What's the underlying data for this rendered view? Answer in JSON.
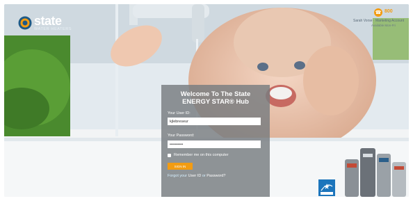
{
  "brand": {
    "logo_text": "state",
    "logo_subtext": "WATER HEATERS"
  },
  "contact": {
    "phone": "800",
    "name": "Sarah Vorse · Marketing Account",
    "hours": "Available Mon-Fri"
  },
  "login": {
    "title": "Welcome To The State ENERGY STAR® Hub",
    "user_id_label": "Your User ID:",
    "user_id_value": "kjlebreseur",
    "password_label": "Your Password:",
    "password_value": "••••••••••",
    "remember_label": "Remember me on this computer",
    "signin_label": "SIGN IN",
    "forgot_prefix": "Forgot your",
    "forgot_user": "User ID",
    "forgot_or": "or",
    "forgot_pass": "Password?"
  },
  "icons": [
    "state-logo-icon",
    "phone-icon",
    "energy-star-icon"
  ],
  "colors": {
    "accent": "#f39c12",
    "panel": "#787c80",
    "logo_blue": "#1f5a86"
  }
}
